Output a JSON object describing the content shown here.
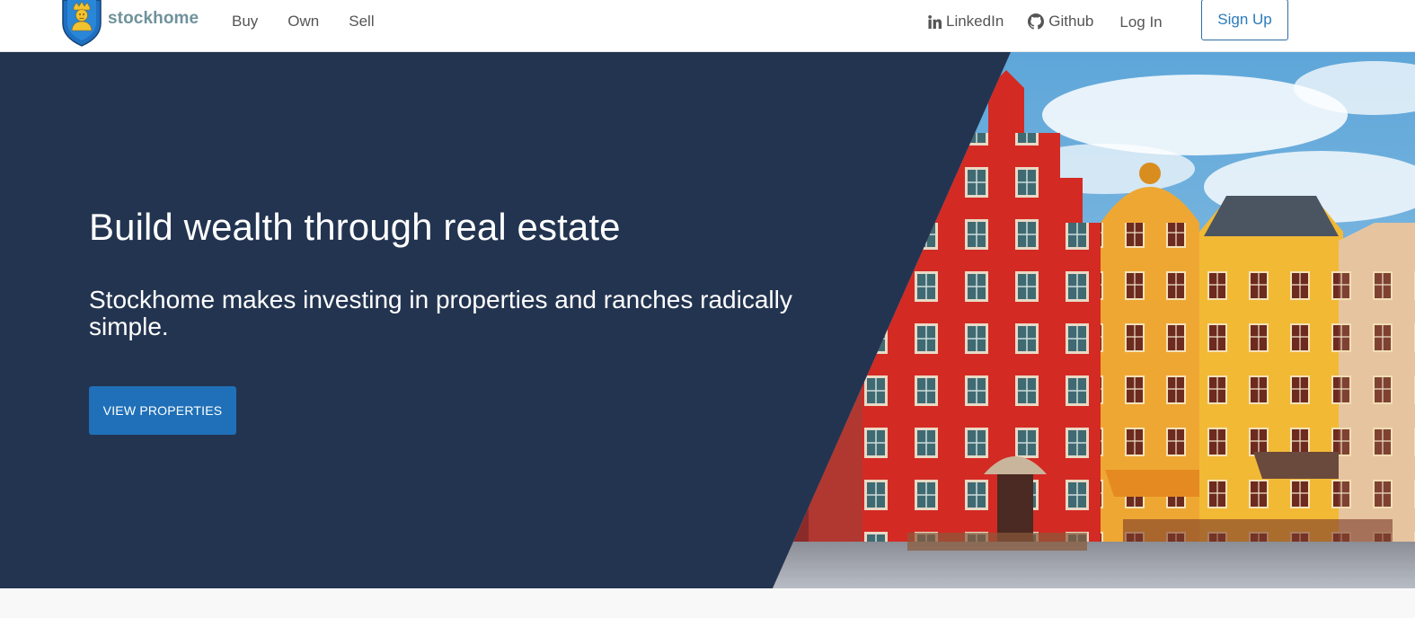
{
  "brand": {
    "name": "stockhome",
    "logo_icon": "stockholm-crest-icon"
  },
  "nav": {
    "left": [
      {
        "label": "Buy"
      },
      {
        "label": "Own"
      },
      {
        "label": "Sell"
      }
    ],
    "right": {
      "linkedin": {
        "label": "LinkedIn",
        "icon": "linkedin-icon"
      },
      "github": {
        "label": "Github",
        "icon": "github-icon"
      },
      "login": {
        "label": "Log In"
      },
      "signup": {
        "label": "Sign Up"
      }
    }
  },
  "hero": {
    "title": "Build wealth through real estate",
    "subtitle": "Stockhome makes investing in properties and ranches radically simple.",
    "button_label": "VIEW PROPERTIES",
    "image_subject": "colorful-stockholm-old-town-facades-photo"
  },
  "colors": {
    "nav_bg": "#ffffff",
    "hero_bg": "#233450",
    "brand_text": "#6f929b",
    "primary": "#1f70b8",
    "signup_border": "#2b6ea5"
  }
}
